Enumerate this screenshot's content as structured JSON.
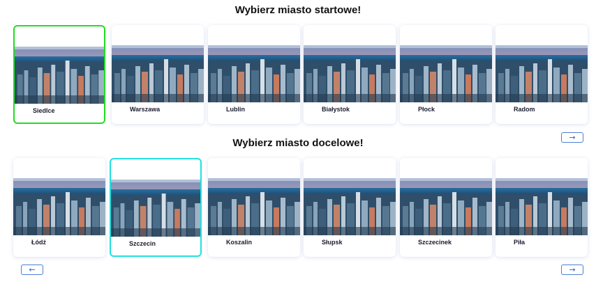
{
  "start_section": {
    "title": "Wybierz miasto startowe!",
    "selected": "Siedlce",
    "cities": [
      "Siedlce",
      "Warszawa",
      "Lublin",
      "Białystok",
      "Płock",
      "Radom"
    ],
    "next_icon": "arrow-right-icon"
  },
  "destination_section": {
    "title": "Wybierz miasto docelowe!",
    "selected": "Szczecin",
    "cities": [
      "Łódź",
      "Szczecin",
      "Koszalin",
      "Słupsk",
      "Szczecinek",
      "Piła"
    ],
    "prev_icon": "arrow-left-icon",
    "next_icon": "arrow-right-icon"
  },
  "colors": {
    "start_selected_border": "#22dd22",
    "destination_selected_border": "#22e0e0",
    "nav_button_border": "#4a7fd4"
  },
  "nav": {
    "prev_glyph": "←",
    "next_glyph": "→"
  }
}
